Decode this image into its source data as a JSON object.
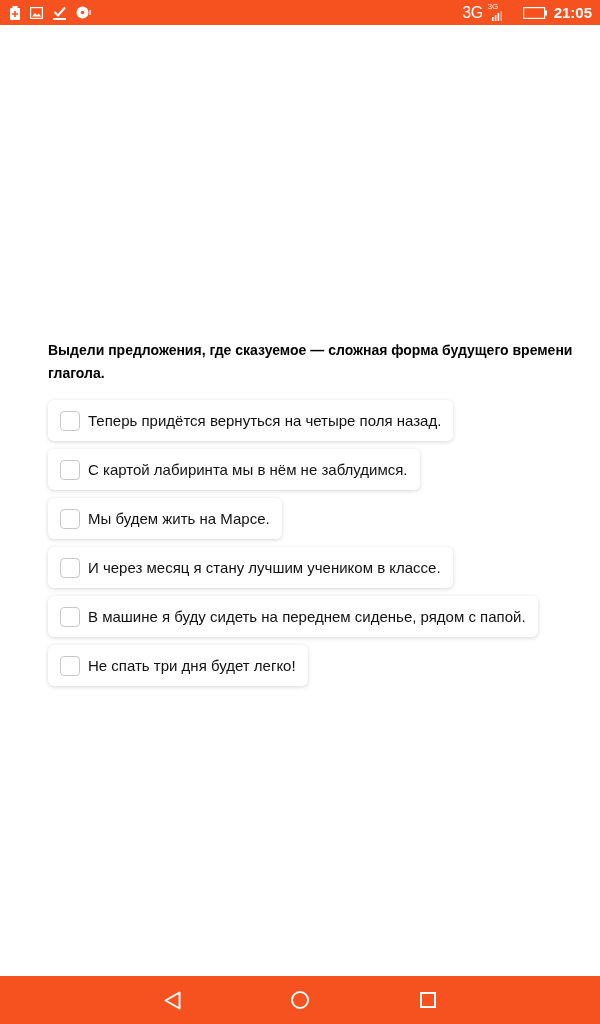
{
  "status_bar": {
    "network": "3G",
    "network_small": "3G",
    "time": "21:05"
  },
  "question": {
    "text": "Выдели предложения, где сказуемое — сложная форма будущего времени глагола."
  },
  "options": [
    {
      "text": "Теперь придётся вернуться на четыре поля назад.",
      "checked": false
    },
    {
      "text": "С картой лабиринта мы в нём не заблудимся.",
      "checked": false
    },
    {
      "text": "Мы будем жить на Марсе.",
      "checked": false
    },
    {
      "text": "И через месяц я стану лучшим учеником в классе.",
      "checked": false
    },
    {
      "text": "В машине я буду сидеть на переднем сиденье, рядом с папой.",
      "checked": false
    },
    {
      "text": "Не спать три дня будет легко!",
      "checked": false
    }
  ]
}
